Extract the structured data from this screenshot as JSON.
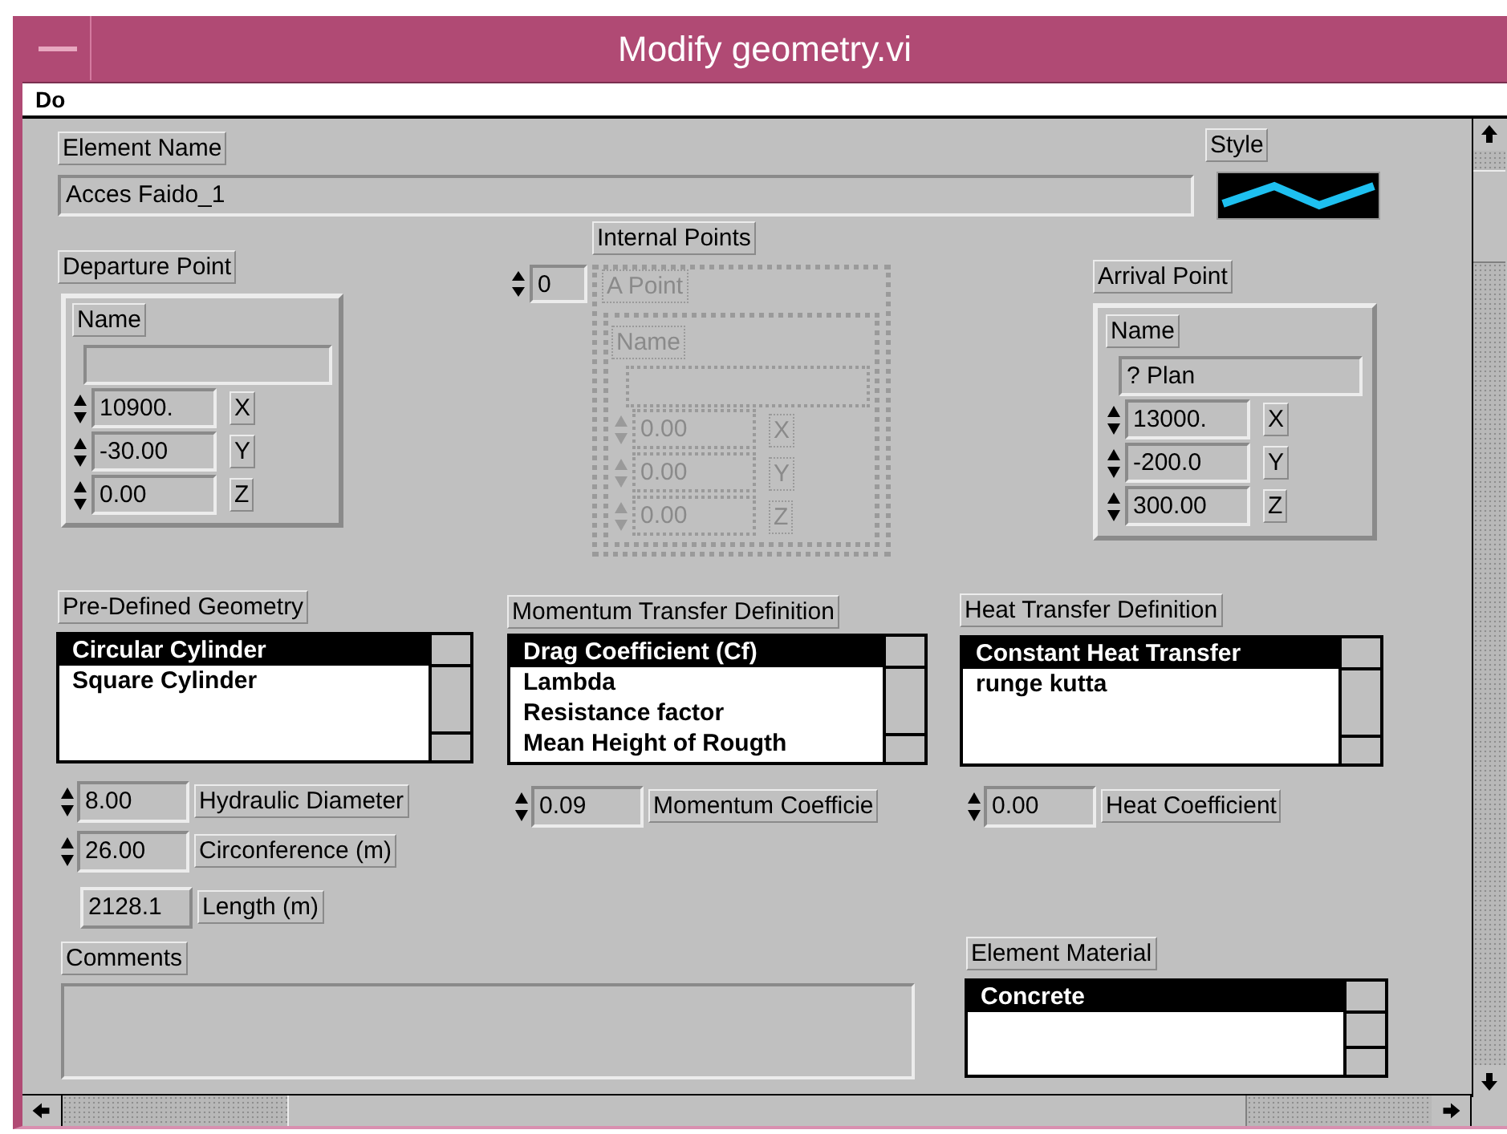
{
  "window": {
    "title": "Modify geometry.vi"
  },
  "menu": [
    "Do"
  ],
  "element_name": {
    "label": "Element Name",
    "value": "Acces Faido_1"
  },
  "style": {
    "label": "Style"
  },
  "departure_point": {
    "label": "Departure Point",
    "name_label": "Name",
    "disabled": false,
    "coords": [
      {
        "value": "10900.",
        "axis": "X"
      },
      {
        "value": "-30.00",
        "axis": "Y"
      },
      {
        "value": "0.00",
        "axis": "Z"
      }
    ]
  },
  "internal_points": {
    "label": "Internal Points",
    "index": "0",
    "point_label": "A Point",
    "name_label": "Name",
    "disabled": true,
    "coords": [
      {
        "value": "0.00",
        "axis": "X"
      },
      {
        "value": "0.00",
        "axis": "Y"
      },
      {
        "value": "0.00",
        "axis": "Z"
      }
    ]
  },
  "arrival_point": {
    "label": "Arrival Point",
    "name_label": "Name",
    "name_value": "? Plan",
    "disabled": false,
    "coords": [
      {
        "value": "13000.",
        "axis": "X"
      },
      {
        "value": "-200.0",
        "axis": "Y"
      },
      {
        "value": "300.00",
        "axis": "Z"
      }
    ]
  },
  "lists": [
    {
      "label": "Pre-Defined Geometry",
      "items": [
        {
          "text": "Circular Cylinder",
          "selected": true
        },
        {
          "text": "Square Cylinder",
          "selected": false
        }
      ]
    },
    {
      "label": "Momentum Transfer Definition",
      "items": [
        {
          "text": "Drag Coefficient (Cf)",
          "selected": true
        },
        {
          "text": "Lambda",
          "selected": false
        },
        {
          "text": "Resistance factor",
          "selected": false
        },
        {
          "text": "Mean Height of Rougth",
          "selected": false
        }
      ]
    },
    {
      "label": "Heat Transfer Definition",
      "items": [
        {
          "text": "Constant Heat Transfer",
          "selected": true
        },
        {
          "text": "runge kutta",
          "selected": false
        }
      ]
    },
    {
      "label": "Element Material",
      "items": [
        {
          "text": "Concrete",
          "selected": true
        }
      ]
    }
  ],
  "parameters": [
    {
      "kind": "spin",
      "value": "8.00",
      "label": "Hydraulic Diameter"
    },
    {
      "kind": "spin",
      "value": "0.09",
      "label": "Momentum Coefficie"
    },
    {
      "kind": "spin",
      "value": "0.00",
      "label": "Heat Coefficient"
    },
    {
      "kind": "spin",
      "value": "26.00",
      "label": "Circonference (m)"
    },
    {
      "kind": "plain",
      "value": "2128.1",
      "label": "Length (m)"
    }
  ],
  "comments": {
    "label": "Comments"
  }
}
